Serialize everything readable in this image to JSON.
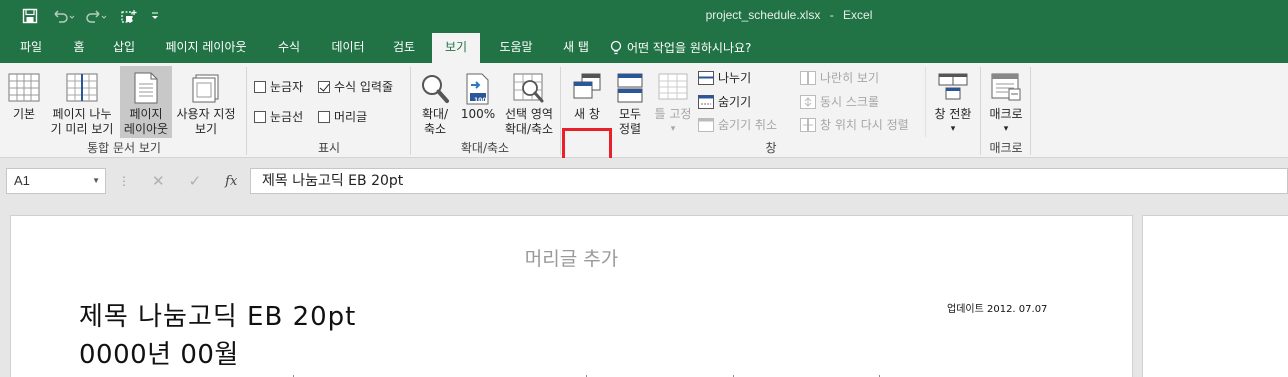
{
  "titlebar": {
    "filename": "project_schedule.xlsx",
    "separator": "-",
    "app": "Excel"
  },
  "tabs": [
    "파일",
    "홈",
    "삽입",
    "페이지 레이아웃",
    "수식",
    "데이터",
    "검토",
    "보기",
    "도움말",
    "새 탭"
  ],
  "active_tab": "보기",
  "tell_me": "어떤 작업을 원하시나요?",
  "ribbon": {
    "workbook_views": {
      "group_label": "통합 문서 보기",
      "normal": "기본",
      "page_break_1": "페이지 나누",
      "page_break_2": "기 미리 보기",
      "page_layout_1": "페이지",
      "page_layout_2": "레이아웃",
      "custom_1": "사용자 지정",
      "custom_2": "보기"
    },
    "show": {
      "group_label": "표시",
      "ruler": "눈금자",
      "formula_bar": "수식 입력줄",
      "gridlines": "눈금선",
      "headings": "머리글",
      "ruler_checked": false,
      "formula_bar_checked": true,
      "gridlines_checked": false,
      "headings_checked": false
    },
    "zoom": {
      "group_label": "확대/축소",
      "zoom_1": "확대/",
      "zoom_2": "축소",
      "hundred": "100%",
      "to_sel_1": "선택 영역",
      "to_sel_2": "확대/축소",
      "hundred_icon_text": "100"
    },
    "window": {
      "group_label": "창",
      "new_window": "새 창",
      "arrange_1": "모두",
      "arrange_2": "정렬",
      "freeze": "틀 고정",
      "split": "나누기",
      "hide": "숨기기",
      "unhide": "숨기기 취소",
      "side_by_side": "나란히 보기",
      "sync_scroll": "동시 스크롤",
      "reset_pos": "창 위치 다시 정렬",
      "switch_1": "창 전환"
    },
    "macros": {
      "group_label": "매크로",
      "macros_1": "매크로"
    }
  },
  "formula_bar": {
    "name_box": "A1",
    "content": "제목 나눔고딕 EB 20pt"
  },
  "sheet": {
    "header_placeholder": "머리글 추가",
    "title": "제목 나눔고딕 EB 20pt",
    "subtitle": "0000년 00월",
    "update_note": "업데이트 2012. 07.07"
  },
  "colors": {
    "excel_green": "#217346",
    "highlight_red": "#e8202a"
  }
}
